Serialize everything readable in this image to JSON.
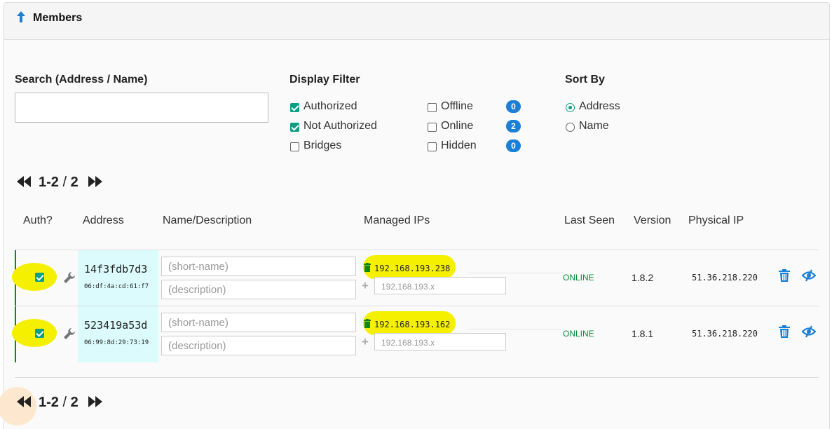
{
  "panel": {
    "title": "Members"
  },
  "search": {
    "label": "Search (Address / Name)",
    "value": "",
    "placeholder": ""
  },
  "display_filter": {
    "label": "Display Filter",
    "authorized": "Authorized",
    "not_authorized": "Not Authorized",
    "bridges": "Bridges",
    "offline": "Offline",
    "online": "Online",
    "hidden": "Hidden",
    "offline_count": "0",
    "online_count": "2",
    "hidden_count": "0"
  },
  "sort_by": {
    "label": "Sort By",
    "address": "Address",
    "name": "Name"
  },
  "pager": {
    "range": "1-2",
    "sep": "/",
    "total": "2"
  },
  "columns": {
    "auth": "Auth?",
    "address": "Address",
    "name_desc": "Name/Description",
    "managed_ips": "Managed IPs",
    "last_seen": "Last Seen",
    "version": "Version",
    "physical_ip": "Physical IP"
  },
  "members": [
    {
      "address": "14f3fdb7d3",
      "mac": "06:df:4a:cd:61:f7",
      "name_placeholder": "(short-name)",
      "desc_placeholder": "(description)",
      "ip": "192.168.193.238",
      "new_ip_placeholder": "192.168.193.x",
      "status": "ONLINE",
      "version": "1.8.2",
      "physical_ip": "51.36.218.220"
    },
    {
      "address": "523419a53d",
      "mac": "06:99:8d:29:73:19",
      "name_placeholder": "(short-name)",
      "desc_placeholder": "(description)",
      "ip": "192.168.193.162",
      "new_ip_placeholder": "192.168.193.x",
      "status": "ONLINE",
      "version": "1.8.1",
      "physical_ip": "51.36.218.220"
    }
  ],
  "colors": {
    "accent": "#0a9e86",
    "badge": "#1a7fd6",
    "highlight": "#f4f000",
    "address_bg": "#dbfbfd",
    "online": "#0a8a3a"
  }
}
